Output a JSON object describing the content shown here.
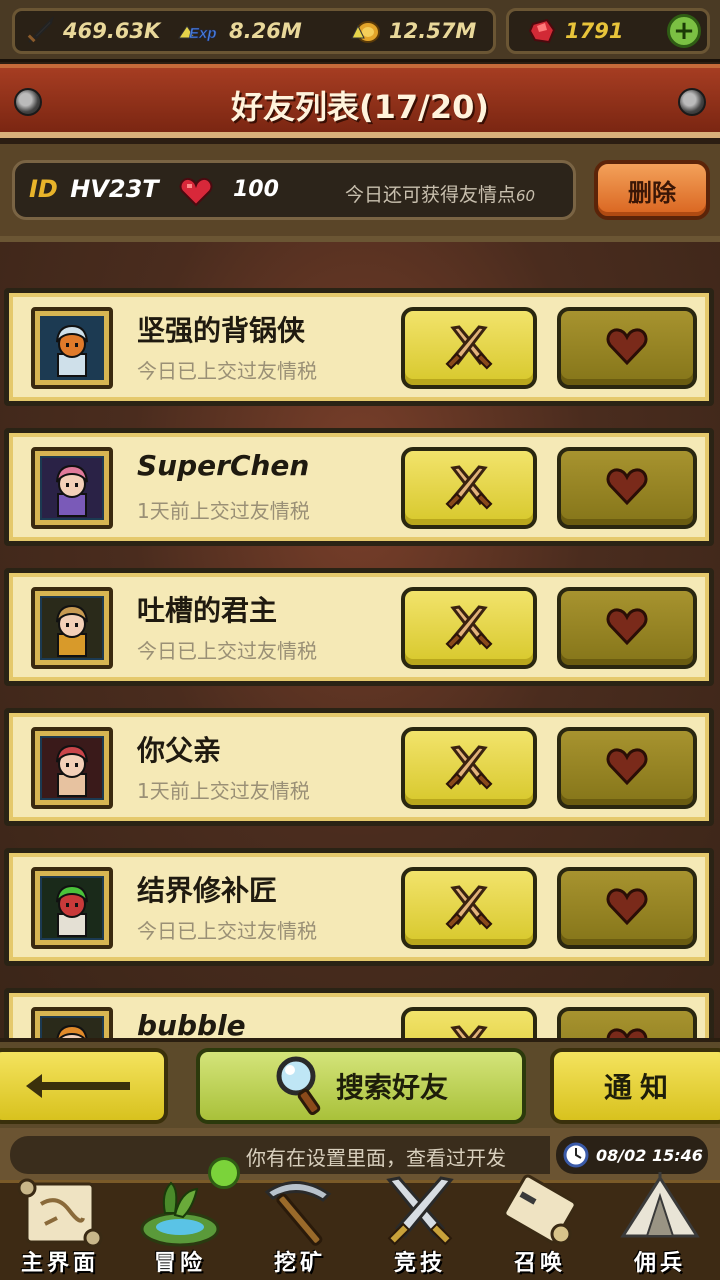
{
  "resources": {
    "attack": "469.63K",
    "exp": "8.26M",
    "gold": "12.57M",
    "gems": "1791",
    "exp_badge": "Exp"
  },
  "title": "好友列表(17/20)",
  "info": {
    "id_label": "ID",
    "id_value": "HV23T",
    "hearts": "100",
    "note": "今日还可获得友情点",
    "note_num": "60",
    "delete_label": "删除"
  },
  "friends": [
    {
      "name": "坚强的背锅侠",
      "status": "今日已上交过友情税",
      "italic": false,
      "avatar": "bear"
    },
    {
      "name": "SuperChen",
      "status": "1天前上交过友情税",
      "italic": true,
      "avatar": "pink"
    },
    {
      "name": "吐槽的君主",
      "status": "今日已上交过友情税",
      "italic": false,
      "avatar": "blonde"
    },
    {
      "name": "你父亲",
      "status": "1天前上交过友情税",
      "italic": false,
      "avatar": "red"
    },
    {
      "name": "结界修补匠",
      "status": "今日已上交过友情税",
      "italic": false,
      "avatar": "green"
    },
    {
      "name": "bubble",
      "status": "",
      "italic": true,
      "avatar": "orange"
    }
  ],
  "actions": {
    "search_label": "搜索好友",
    "notify_label": "通知"
  },
  "ticker": {
    "text": "你有在设置里面，查看过开发",
    "clock": "08/02 15:46"
  },
  "nav": [
    {
      "label": "主界面"
    },
    {
      "label": "冒险"
    },
    {
      "label": "挖矿"
    },
    {
      "label": "竞技"
    },
    {
      "label": "召唤"
    },
    {
      "label": "佣兵"
    }
  ],
  "colors": {
    "title_banner": "#8f2f18",
    "card_bg": "#f5e9b6",
    "battle_btn": "#e8d846",
    "gift_btn": "#968422",
    "heart": "#c8283a"
  }
}
